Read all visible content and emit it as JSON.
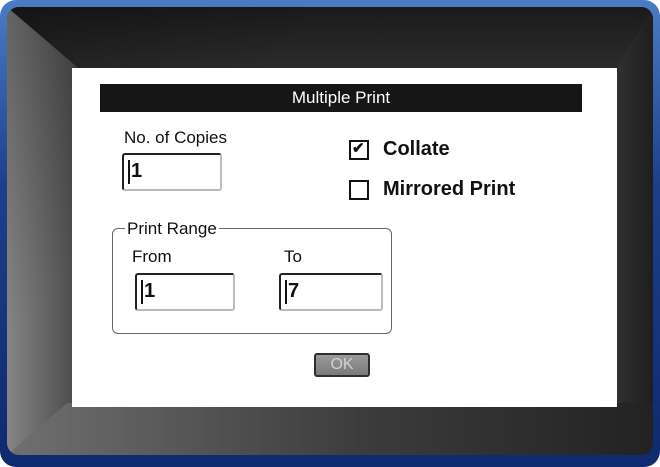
{
  "dialog": {
    "title": "Multiple Print",
    "copies": {
      "label": "No. of Copies",
      "value": "1"
    },
    "collate": {
      "label": "Collate",
      "checked": true
    },
    "mirrored_print": {
      "label": "Mirrored Print",
      "checked": false
    },
    "print_range": {
      "legend": "Print Range",
      "from": {
        "label": "From",
        "value": "1"
      },
      "to": {
        "label": "To",
        "value": "7"
      }
    },
    "ok_label": "OK"
  },
  "colors": {
    "title_bar": "#161616",
    "frame_accent": "#1d3f8a",
    "ok_button": "#8a8a8a"
  },
  "icons": {
    "check": "check-icon"
  }
}
